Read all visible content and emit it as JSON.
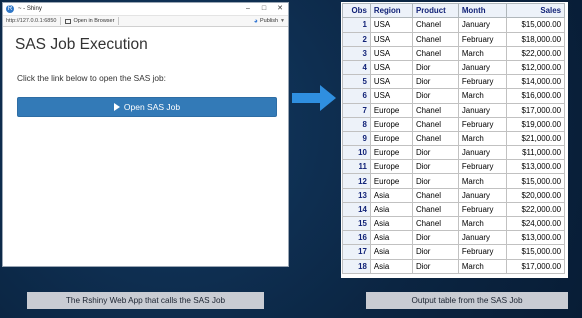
{
  "browser": {
    "window_title": "~ - Shiny",
    "url": "http://127.0.0.1:6850",
    "open_in_browser_label": "Open in Browser",
    "publish_label": "Publish",
    "page_title": "SAS Job Execution",
    "instruction": "Click the link below to open the SAS job:",
    "run_button_label": "Open SAS Job"
  },
  "table": {
    "headers": [
      "Obs",
      "Region",
      "Product",
      "Month",
      "Sales"
    ],
    "rows": [
      [
        "1",
        "USA",
        "Chanel",
        "January",
        "$15,000.00"
      ],
      [
        "2",
        "USA",
        "Chanel",
        "February",
        "$18,000.00"
      ],
      [
        "3",
        "USA",
        "Chanel",
        "March",
        "$22,000.00"
      ],
      [
        "4",
        "USA",
        "Dior",
        "January",
        "$12,000.00"
      ],
      [
        "5",
        "USA",
        "Dior",
        "February",
        "$14,000.00"
      ],
      [
        "6",
        "USA",
        "Dior",
        "March",
        "$16,000.00"
      ],
      [
        "7",
        "Europe",
        "Chanel",
        "January",
        "$17,000.00"
      ],
      [
        "8",
        "Europe",
        "Chanel",
        "February",
        "$19,000.00"
      ],
      [
        "9",
        "Europe",
        "Chanel",
        "March",
        "$21,000.00"
      ],
      [
        "10",
        "Europe",
        "Dior",
        "January",
        "$11,000.00"
      ],
      [
        "11",
        "Europe",
        "Dior",
        "February",
        "$13,000.00"
      ],
      [
        "12",
        "Europe",
        "Dior",
        "March",
        "$15,000.00"
      ],
      [
        "13",
        "Asia",
        "Chanel",
        "January",
        "$20,000.00"
      ],
      [
        "14",
        "Asia",
        "Chanel",
        "February",
        "$22,000.00"
      ],
      [
        "15",
        "Asia",
        "Chanel",
        "March",
        "$24,000.00"
      ],
      [
        "16",
        "Asia",
        "Dior",
        "January",
        "$13,000.00"
      ],
      [
        "17",
        "Asia",
        "Dior",
        "February",
        "$15,000.00"
      ],
      [
        "18",
        "Asia",
        "Dior",
        "March",
        "$17,000.00"
      ]
    ]
  },
  "captions": {
    "left": "The Rshiny Web App that calls the SAS Job",
    "right": "Output table from the SAS Job"
  },
  "colors": {
    "background": "#0d2b4d",
    "button": "#337ab7",
    "arrow": "#2f8fe0",
    "table_header_bg": "#edf2f9",
    "table_header_text": "#112277"
  }
}
